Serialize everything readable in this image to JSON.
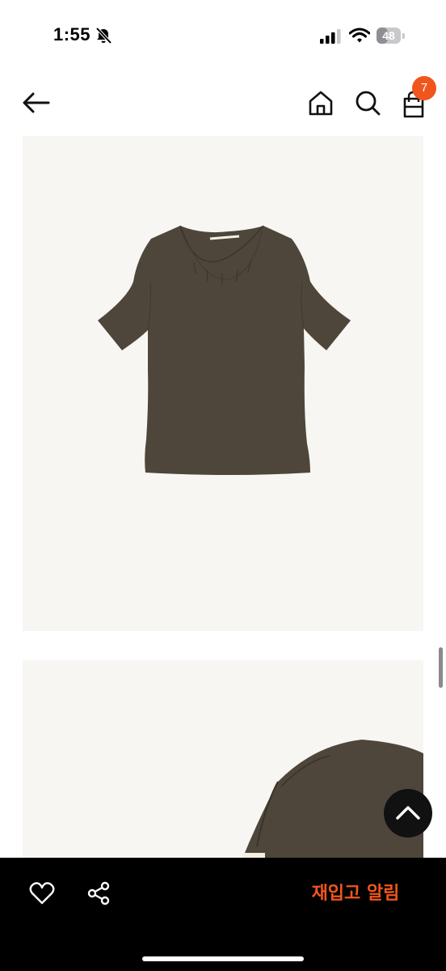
{
  "status_bar": {
    "time": "1:55",
    "battery_level": "48"
  },
  "nav": {
    "cart_count": "7"
  },
  "product": {
    "shirt_color": "#4e463a"
  },
  "bottom_bar": {
    "restock_label": "재입고 알림"
  },
  "colors": {
    "accent": "#f0561c",
    "image_bg": "#f7f6f3"
  }
}
